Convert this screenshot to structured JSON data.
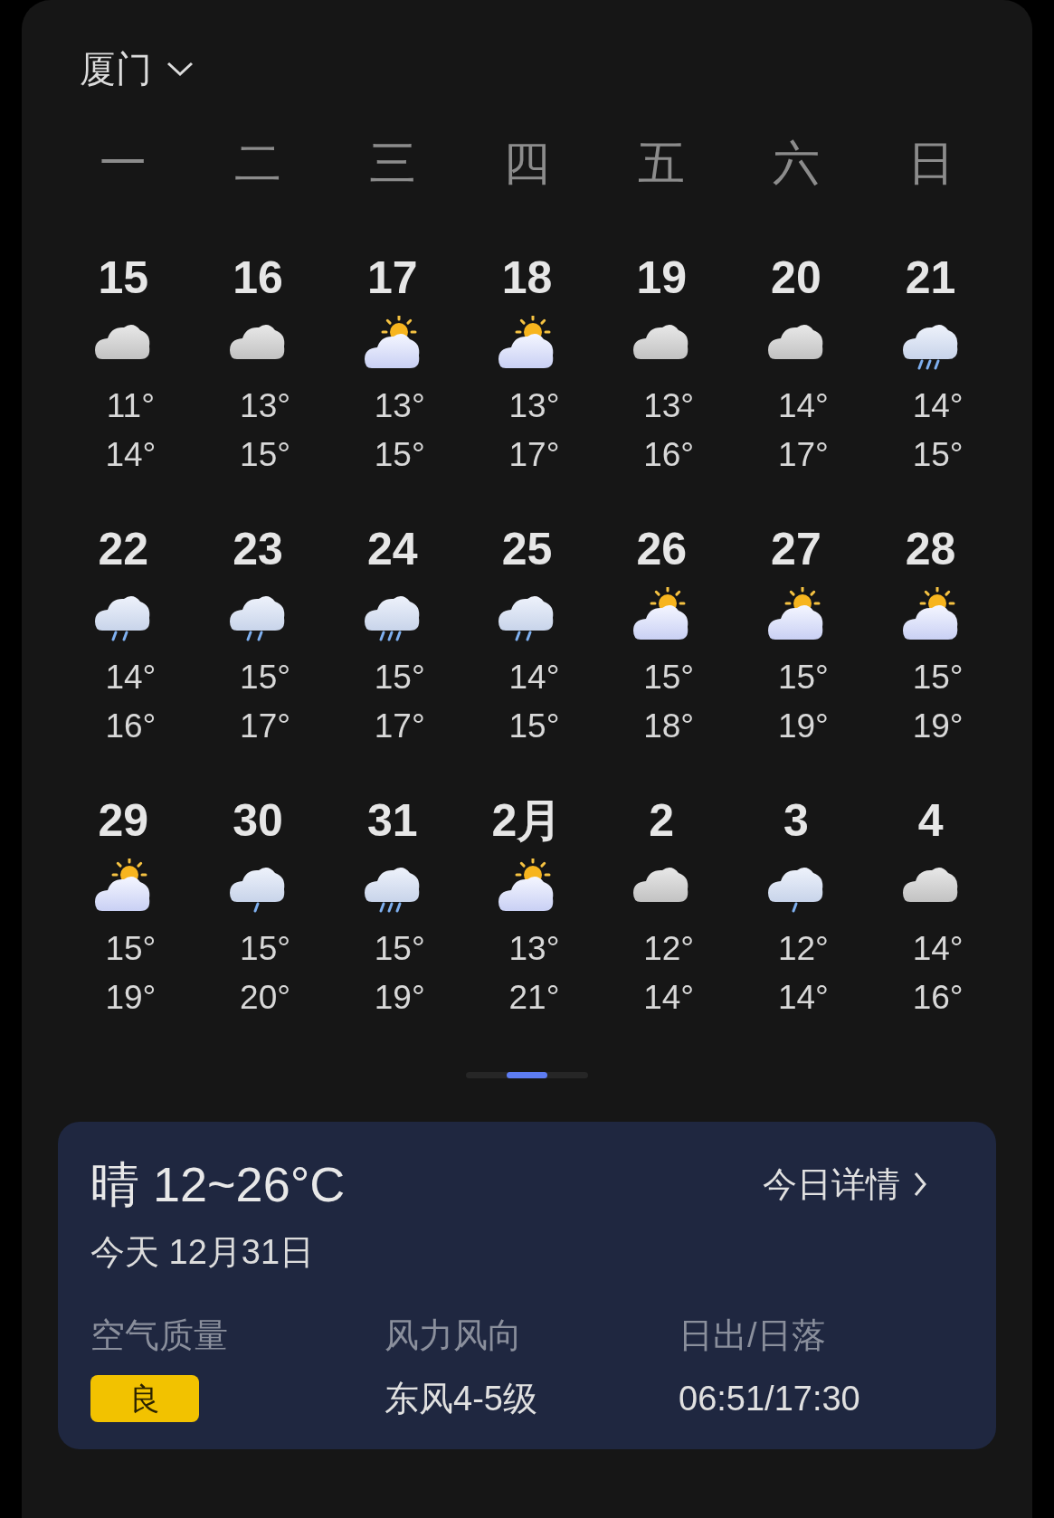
{
  "location": {
    "city": "厦门",
    "expanded": false
  },
  "weekdays": [
    "一",
    "二",
    "三",
    "四",
    "五",
    "六",
    "日"
  ],
  "weeks": [
    [
      {
        "date": "15",
        "kind": "cloudy",
        "low": "11°",
        "high": "14°"
      },
      {
        "date": "16",
        "kind": "cloudy",
        "low": "13°",
        "high": "15°"
      },
      {
        "date": "17",
        "kind": "partly_sunny",
        "low": "13°",
        "high": "15°"
      },
      {
        "date": "18",
        "kind": "partly_sunny",
        "low": "13°",
        "high": "17°"
      },
      {
        "date": "19",
        "kind": "cloudy",
        "low": "13°",
        "high": "16°"
      },
      {
        "date": "20",
        "kind": "cloudy",
        "low": "14°",
        "high": "17°"
      },
      {
        "date": "21",
        "kind": "heavy_rain",
        "low": "14°",
        "high": "15°"
      }
    ],
    [
      {
        "date": "22",
        "kind": "moderate_rain",
        "low": "14°",
        "high": "16°"
      },
      {
        "date": "23",
        "kind": "moderate_rain",
        "low": "15°",
        "high": "17°"
      },
      {
        "date": "24",
        "kind": "heavy_rain",
        "low": "15°",
        "high": "17°"
      },
      {
        "date": "25",
        "kind": "moderate_rain",
        "low": "14°",
        "high": "15°"
      },
      {
        "date": "26",
        "kind": "partly_sunny",
        "low": "15°",
        "high": "18°"
      },
      {
        "date": "27",
        "kind": "partly_sunny",
        "low": "15°",
        "high": "19°"
      },
      {
        "date": "28",
        "kind": "partly_sunny",
        "low": "15°",
        "high": "19°"
      }
    ],
    [
      {
        "date": "29",
        "kind": "partly_sunny",
        "low": "15°",
        "high": "19°"
      },
      {
        "date": "30",
        "kind": "light_rain",
        "low": "15°",
        "high": "20°"
      },
      {
        "date": "31",
        "kind": "heavy_rain",
        "low": "15°",
        "high": "19°"
      },
      {
        "date": "2月",
        "kind": "partly_sunny",
        "low": "13°",
        "high": "21°"
      },
      {
        "date": "2",
        "kind": "cloudy",
        "low": "12°",
        "high": "14°"
      },
      {
        "date": "3",
        "kind": "light_rain",
        "low": "12°",
        "high": "14°"
      },
      {
        "date": "4",
        "kind": "cloudy",
        "low": "14°",
        "high": "16°"
      }
    ]
  ],
  "pager": [
    {
      "selected": false
    },
    {
      "selected": true
    },
    {
      "selected": false
    }
  ],
  "today": {
    "summary": "晴 12~26°C",
    "details_link": "今日详情",
    "date": "今天 12月31日",
    "stats": [
      {
        "kind": "badge",
        "label": "空气质量",
        "value": "良",
        "color": "#f2c200"
      },
      {
        "kind": "text",
        "label": "风力风向",
        "value": "东风4-5级"
      },
      {
        "kind": "text",
        "label": "日出/日落",
        "value": "06:51/17:30"
      }
    ]
  }
}
